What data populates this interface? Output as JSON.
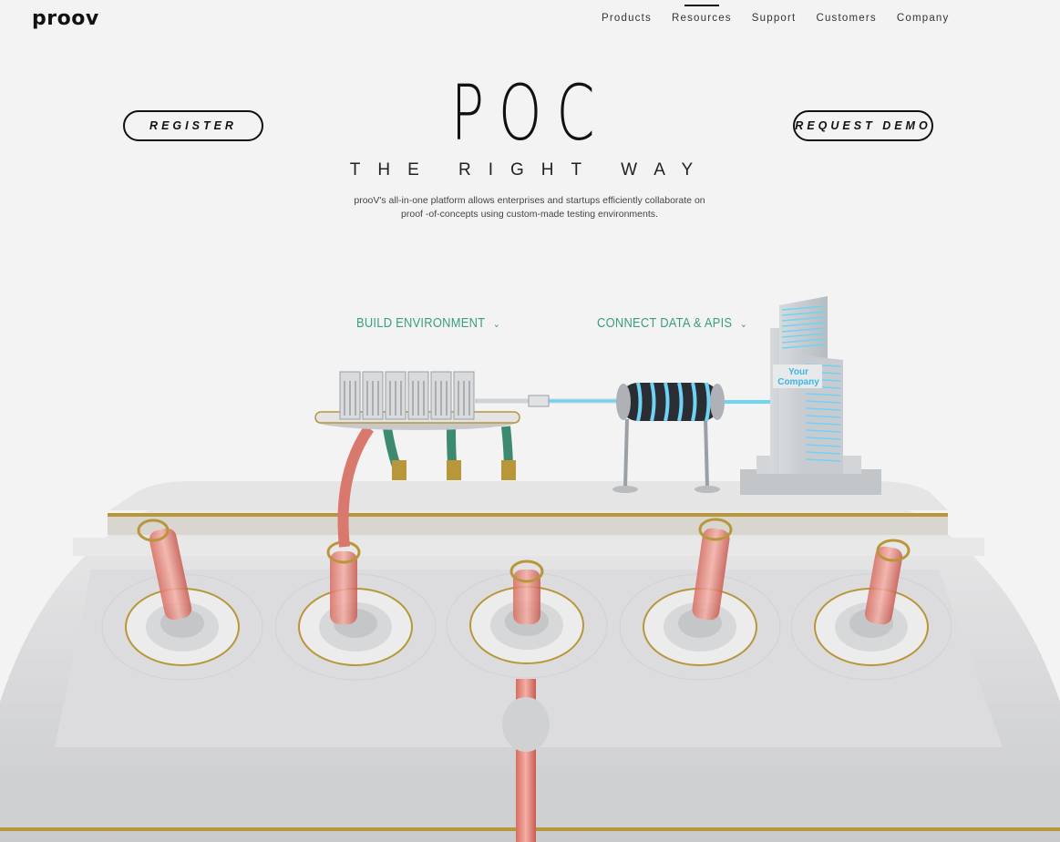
{
  "brand": {
    "logo": "proov"
  },
  "nav": {
    "items": [
      {
        "label": "Products"
      },
      {
        "label": "Resources"
      },
      {
        "label": "Support"
      },
      {
        "label": "Customers"
      },
      {
        "label": "Company"
      }
    ],
    "active": "Resources"
  },
  "hero": {
    "title": "POC",
    "subtitle": "THE RIGHT WAY",
    "description": "prooV's all-in-one platform allows enterprises and startups efficiently collaborate on proof -of-concepts using custom-made testing environments.",
    "register_label": "REGISTER",
    "demo_label": "REQUEST DEMO"
  },
  "steps": [
    {
      "label": "BUILD ENVIRONMENT"
    },
    {
      "label": "CONNECT DATA & APIS"
    }
  ],
  "illustration": {
    "building_label_line1": "Your",
    "building_label_line2": "Company"
  },
  "colors": {
    "accent_green": "#3b9e7f",
    "liquid": "#e0857a",
    "cable_blue": "#6fd3f5",
    "gold": "#b8973a"
  }
}
